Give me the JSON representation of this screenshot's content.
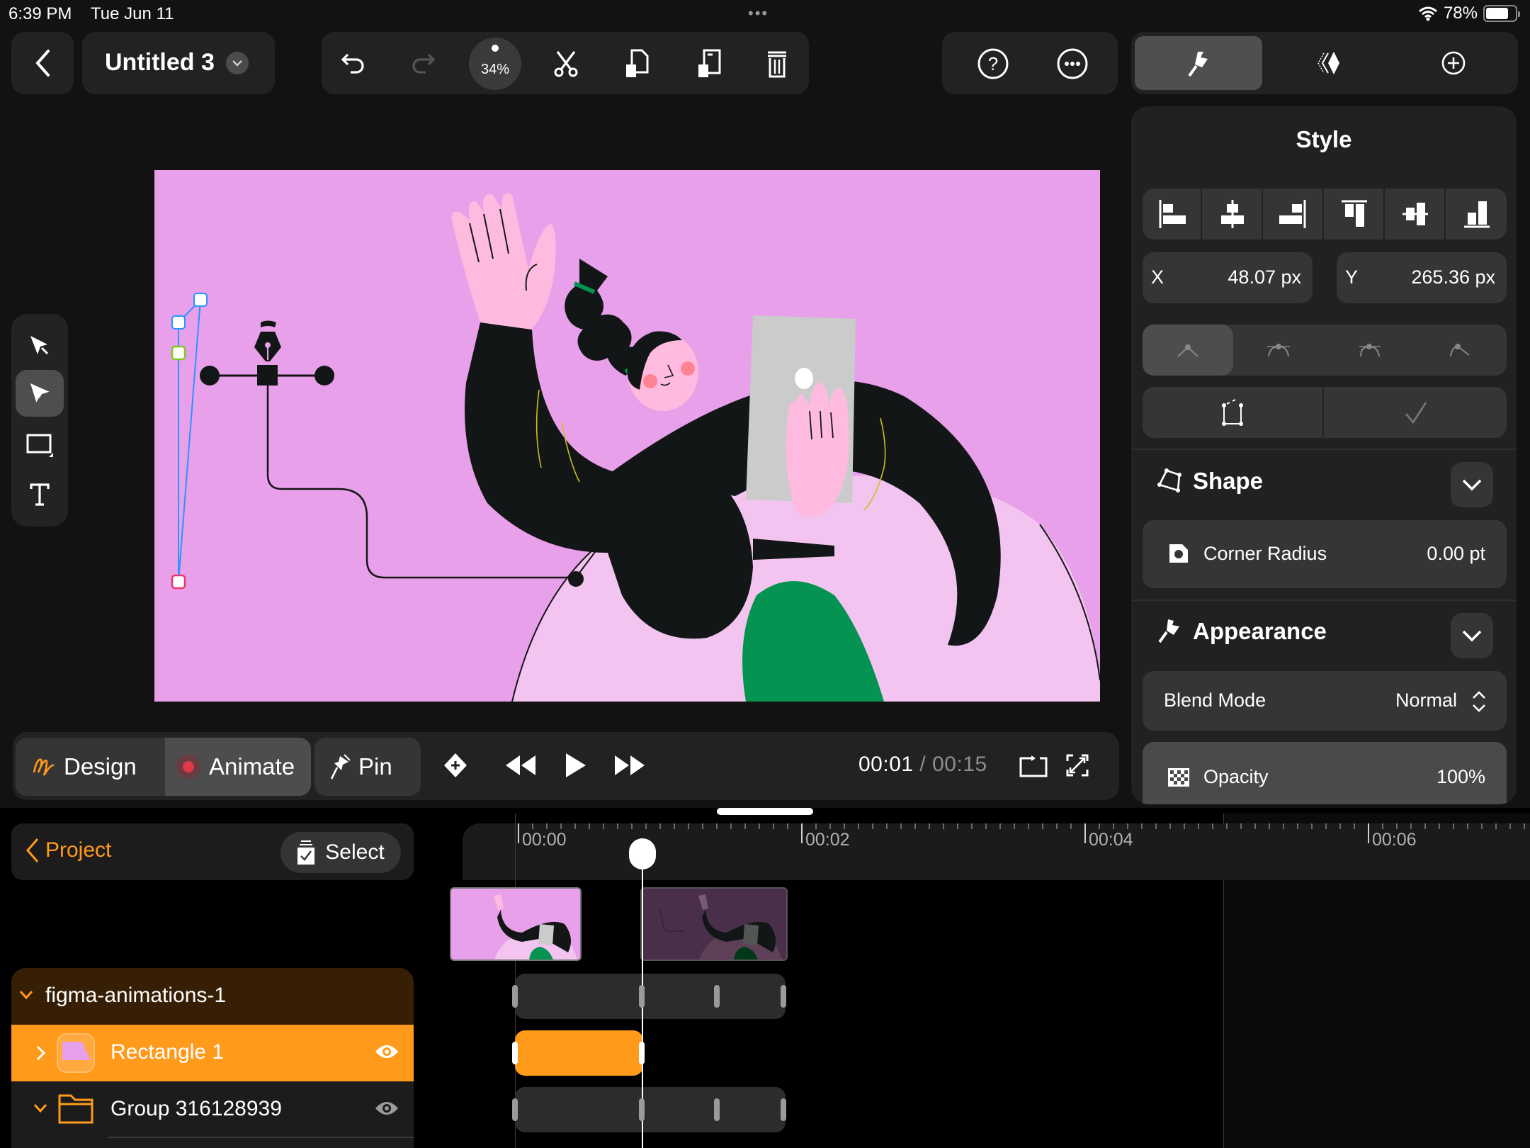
{
  "status_bar": {
    "time": "6:39 PM",
    "date": "Tue Jun 11",
    "more_dots": "•••",
    "battery_percent": "78%",
    "battery_level": 0.78,
    "wifi_icon": "wifi-icon"
  },
  "toolbar": {
    "back_icon": "chevron-left-icon",
    "document_title": "Untitled 3",
    "title_menu_icon": "chevron-down-icon",
    "undo_icon": "undo-icon",
    "redo_icon": "redo-icon",
    "zoom_level": "34%",
    "cut_icon": "scissors-icon",
    "copy_icon": "copy-icon",
    "paste_icon": "paste-icon",
    "delete_icon": "trash-icon",
    "help_icon": "help-icon",
    "more_icon": "more-icon",
    "inspector_tabs": [
      {
        "icon": "brush-icon",
        "active": true
      },
      {
        "icon": "keyframes-icon",
        "active": false
      },
      {
        "icon": "add-icon",
        "active": false
      }
    ]
  },
  "tools": [
    {
      "name": "select",
      "icon": "arrow-pointer-icon",
      "active": false
    },
    {
      "name": "direct-select",
      "icon": "node-pointer-icon",
      "active": true
    },
    {
      "name": "rectangle",
      "icon": "rectangle-icon",
      "active": false,
      "has_submenu": true
    },
    {
      "name": "text",
      "icon": "text-icon",
      "active": false
    }
  ],
  "playback": {
    "modes": [
      {
        "label": "Design",
        "icon": "design-squiggle-icon",
        "active": false
      },
      {
        "label": "Animate",
        "icon": "record-dot-icon",
        "active": true
      },
      {
        "label": "Pin",
        "icon": "pin-icon",
        "active": false
      }
    ],
    "add_keyframe_icon": "add-keyframe-icon",
    "rewind_icon": "rewind-icon",
    "play_icon": "play-icon",
    "fast_forward_icon": "fast-forward-icon",
    "current_time": "00:01",
    "separator": "/",
    "total_time": "00:15",
    "loop_icon": "loop-icon",
    "fullscreen_icon": "expand-icon"
  },
  "inspector": {
    "title": "Style",
    "align_buttons": [
      {
        "icon": "align-left-icon"
      },
      {
        "icon": "align-center-h-icon"
      },
      {
        "icon": "align-right-icon"
      },
      {
        "icon": "align-top-icon"
      },
      {
        "icon": "align-center-v-icon"
      },
      {
        "icon": "align-bottom-icon"
      }
    ],
    "x_label": "X",
    "x_value": "48.07 px",
    "y_label": "Y",
    "y_value": "265.36 px",
    "point_types": [
      {
        "icon": "corner-point-icon",
        "active": true
      },
      {
        "icon": "mirrored-point-icon",
        "active": false
      },
      {
        "icon": "asymmetric-point-icon",
        "active": false
      },
      {
        "icon": "disconnected-point-icon",
        "active": false
      }
    ],
    "path_actions": [
      {
        "icon": "open-path-icon"
      },
      {
        "icon": "checkmark-icon"
      }
    ],
    "shape_section": {
      "title": "Shape",
      "icon": "shape-polygon-icon",
      "corner_radius_label": "Corner Radius",
      "corner_radius_value": "0.00 pt"
    },
    "appearance_section": {
      "title": "Appearance",
      "icon": "brush-icon",
      "blend_mode_label": "Blend Mode",
      "blend_mode_value": "Normal",
      "opacity_label": "Opacity",
      "opacity_value": "100%"
    }
  },
  "timeline": {
    "project_label": "Project",
    "select_label": "Select",
    "ruler_labels": [
      "00:00",
      "00:02",
      "00:04",
      "00:06"
    ],
    "playhead_time_seconds": 0.88,
    "layers": [
      {
        "name": "figma-animations-1",
        "expanded": true,
        "type": "artboard"
      },
      {
        "name": "Rectangle 1",
        "expanded": false,
        "type": "shape",
        "selected": true,
        "visible": true
      },
      {
        "name": "Group 316128939",
        "expanded": true,
        "type": "group",
        "selected": false,
        "visible": true
      }
    ]
  },
  "colors": {
    "accent": "#ff9a1a",
    "canvas_background": "#e9a0ea",
    "panel": "#212121",
    "record_red": "#e0394a",
    "figure_black": "#121616",
    "skin_pink": "#ffbadf",
    "green": "#059352"
  }
}
